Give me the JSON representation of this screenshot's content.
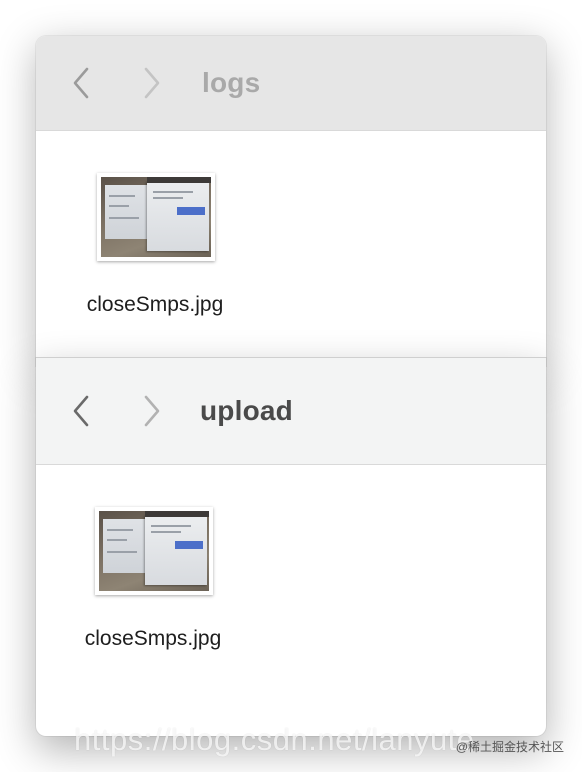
{
  "windows": [
    {
      "folder_title": "logs",
      "files": [
        {
          "name": "closeSmps.jpg",
          "icon": "image-thumbnail-icon"
        }
      ]
    },
    {
      "folder_title": "upload",
      "files": [
        {
          "name": "closeSmps.jpg",
          "icon": "image-thumbnail-icon"
        }
      ]
    }
  ],
  "nav": {
    "back_icon": "chevron-left-icon",
    "forward_icon": "chevron-right-icon"
  },
  "watermark": {
    "url": "https://blog.csdn.net/lanyute",
    "site": "@稀土掘金技术社区"
  },
  "colors": {
    "back_toolbar": "#e6e6e6",
    "front_toolbar": "#f3f4f4",
    "title_inactive": "#a9a9a9",
    "title_active": "#4a4a4a"
  }
}
